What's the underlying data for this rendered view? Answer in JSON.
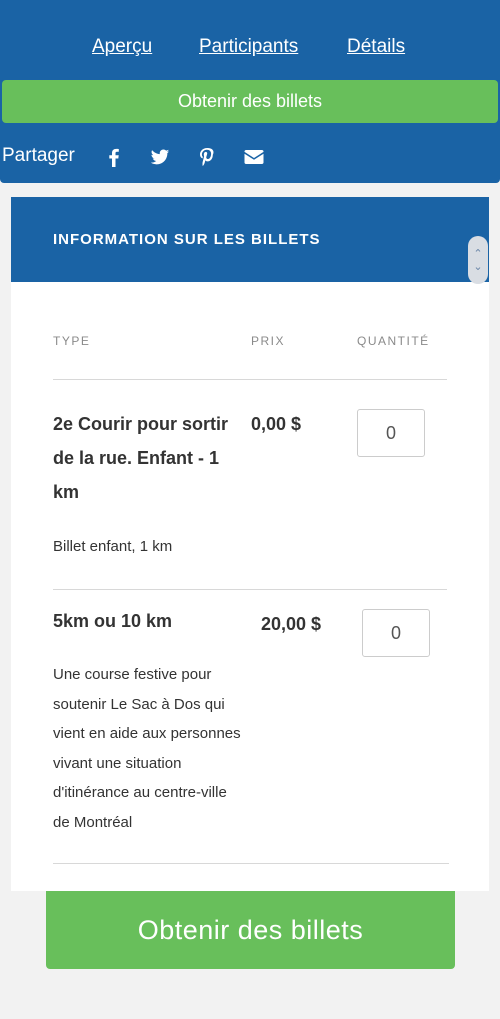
{
  "nav": {
    "overview": "Aperçu",
    "participants": "Participants",
    "details": "Détails"
  },
  "cta_label": "Obtenir des billets",
  "share": {
    "label": "Partager",
    "icons": [
      "facebook-icon",
      "twitter-icon",
      "pinterest-icon",
      "email-icon"
    ]
  },
  "tickets": {
    "title": "INFORMATION SUR LES BILLETS",
    "columns": {
      "type": "TYPE",
      "price": "PRIX",
      "quantity": "QUANTITÉ"
    },
    "items": [
      {
        "name": "2e Courir pour sortir de la rue. Enfant - 1 km",
        "price": "0,00 $",
        "quantity": "0",
        "description": "Billet enfant, 1 km"
      },
      {
        "name": "5km ou 10 km",
        "price": "20,00 $",
        "quantity": "0",
        "description": "Une course festive pour soutenir Le Sac à Dos qui vient en aide aux personnes vivant une situation d'itinérance au centre-ville de Montréal"
      }
    ]
  },
  "colors": {
    "primary": "#1a63a5",
    "accent": "#68bf5b"
  }
}
